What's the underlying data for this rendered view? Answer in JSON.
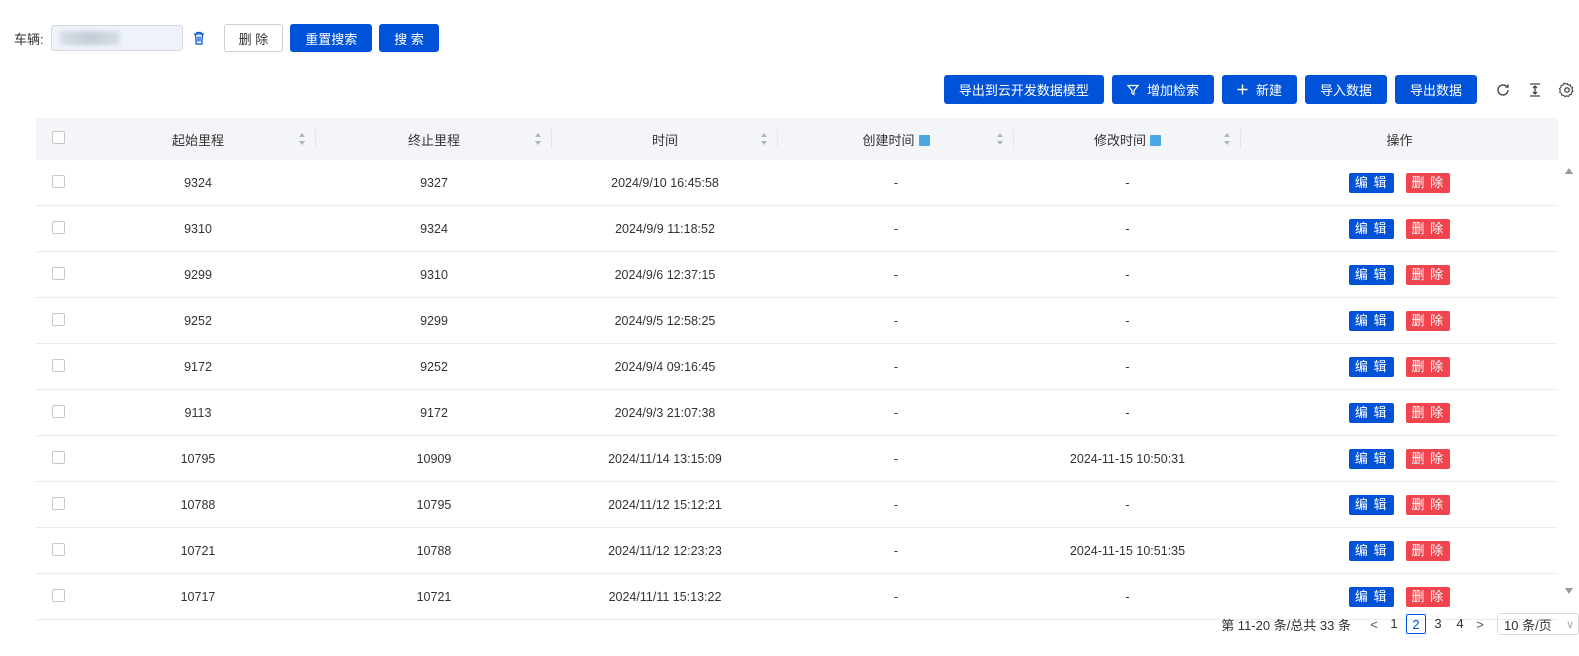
{
  "search": {
    "vehicle_label": "车辆:",
    "delete_label": "删 除",
    "reset_label": "重置搜索",
    "search_label": "搜 索"
  },
  "toolbar": {
    "export_model_label": "导出到云开发数据模型",
    "add_filter_label": "增加检索",
    "new_label": "新建",
    "import_label": "导入数据",
    "export_label": "导出数据"
  },
  "table": {
    "columns": [
      "起始里程",
      "终止里程",
      "时间",
      "创建时间",
      "修改时间",
      "操作"
    ],
    "edit_label": "编 辑",
    "delete_label": "删 除",
    "rows": [
      {
        "start": "9324",
        "end": "9327",
        "time": "2024/9/10 16:45:58",
        "created": "-",
        "modified": "-"
      },
      {
        "start": "9310",
        "end": "9324",
        "time": "2024/9/9 11:18:52",
        "created": "-",
        "modified": "-"
      },
      {
        "start": "9299",
        "end": "9310",
        "time": "2024/9/6 12:37:15",
        "created": "-",
        "modified": "-"
      },
      {
        "start": "9252",
        "end": "9299",
        "time": "2024/9/5 12:58:25",
        "created": "-",
        "modified": "-"
      },
      {
        "start": "9172",
        "end": "9252",
        "time": "2024/9/4 09:16:45",
        "created": "-",
        "modified": "-"
      },
      {
        "start": "9113",
        "end": "9172",
        "time": "2024/9/3 21:07:38",
        "created": "-",
        "modified": "-"
      },
      {
        "start": "10795",
        "end": "10909",
        "time": "2024/11/14 13:15:09",
        "created": "-",
        "modified": "2024-11-15 10:50:31"
      },
      {
        "start": "10788",
        "end": "10795",
        "time": "2024/11/12 15:12:21",
        "created": "-",
        "modified": "-"
      },
      {
        "start": "10721",
        "end": "10788",
        "time": "2024/11/12 12:23:23",
        "created": "-",
        "modified": "2024-11-15 10:51:35"
      },
      {
        "start": "10717",
        "end": "10721",
        "time": "2024/11/11 15:13:22",
        "created": "-",
        "modified": "-"
      }
    ]
  },
  "pagination": {
    "summary": "第 11-20 条/总共 33 条",
    "prev": "<",
    "next": ">",
    "pages": [
      "1",
      "2",
      "3",
      "4"
    ],
    "current": "2",
    "page_size": "10 条/页"
  },
  "colors": {
    "primary": "#0052d9",
    "danger": "#f0454e",
    "header_bg": "#f3f5f8"
  }
}
